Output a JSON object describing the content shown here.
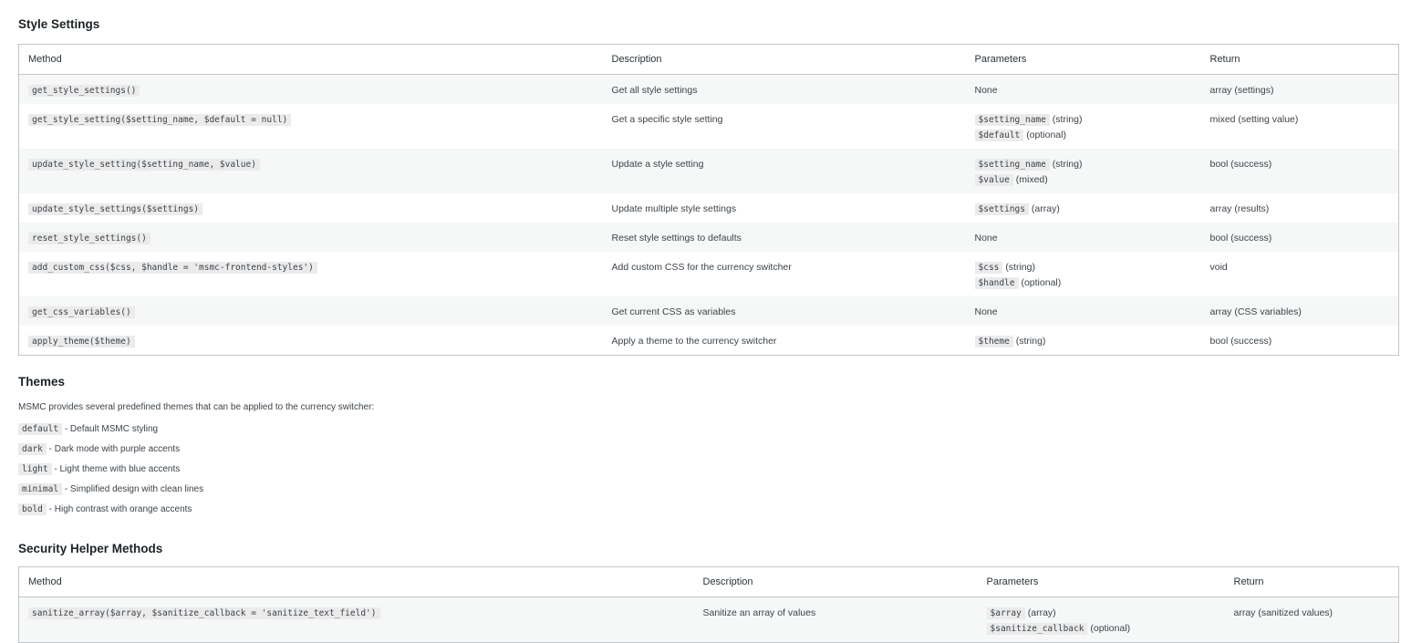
{
  "style_settings": {
    "title": "Style Settings",
    "headers": [
      "Method",
      "Description",
      "Parameters",
      "Return"
    ],
    "rows": [
      {
        "method": "get_style_settings()",
        "description": "Get all style settings",
        "params_plain": "None",
        "params": [],
        "return": "array (settings)"
      },
      {
        "method": "get_style_setting($setting_name, $default = null)",
        "description": "Get a specific style setting",
        "params_plain": "",
        "params": [
          {
            "code": "$setting_name",
            "note": "(string)"
          },
          {
            "code": "$default",
            "note": "(optional)"
          }
        ],
        "return": "mixed (setting value)"
      },
      {
        "method": "update_style_setting($setting_name, $value)",
        "description": "Update a style setting",
        "params_plain": "",
        "params": [
          {
            "code": "$setting_name",
            "note": "(string)"
          },
          {
            "code": "$value",
            "note": "(mixed)"
          }
        ],
        "return": "bool (success)"
      },
      {
        "method": "update_style_settings($settings)",
        "description": "Update multiple style settings",
        "params_plain": "",
        "params": [
          {
            "code": "$settings",
            "note": "(array)"
          }
        ],
        "return": "array (results)"
      },
      {
        "method": "reset_style_settings()",
        "description": "Reset style settings to defaults",
        "params_plain": "None",
        "params": [],
        "return": "bool (success)"
      },
      {
        "method": "add_custom_css($css, $handle = 'msmc-frontend-styles')",
        "description": "Add custom CSS for the currency switcher",
        "params_plain": "",
        "params": [
          {
            "code": "$css",
            "note": "(string)"
          },
          {
            "code": "$handle",
            "note": "(optional)"
          }
        ],
        "return": "void"
      },
      {
        "method": "get_css_variables()",
        "description": "Get current CSS as variables",
        "params_plain": "None",
        "params": [],
        "return": "array (CSS variables)"
      },
      {
        "method": "apply_theme($theme)",
        "description": "Apply a theme to the currency switcher",
        "params_plain": "",
        "params": [
          {
            "code": "$theme",
            "note": "(string)"
          }
        ],
        "return": "bool (success)"
      }
    ]
  },
  "themes": {
    "title": "Themes",
    "intro": "MSMC provides several predefined themes that can be applied to the currency switcher:",
    "items": [
      {
        "code": "default",
        "text": "- Default MSMC styling"
      },
      {
        "code": "dark",
        "text": "- Dark mode with purple accents"
      },
      {
        "code": "light",
        "text": "- Light theme with blue accents"
      },
      {
        "code": "minimal",
        "text": "- Simplified design with clean lines"
      },
      {
        "code": "bold",
        "text": "- High contrast with orange accents"
      }
    ]
  },
  "security": {
    "title": "Security Helper Methods",
    "headers": [
      "Method",
      "Description",
      "Parameters",
      "Return"
    ],
    "rows": [
      {
        "method": "sanitize_array($array, $sanitize_callback = 'sanitize_text_field')",
        "description": "Sanitize an array of values",
        "params_plain": "",
        "params": [
          {
            "code": "$array",
            "note": "(array)"
          },
          {
            "code": "$sanitize_callback",
            "note": "(optional)"
          }
        ],
        "return": "array (sanitized values)"
      }
    ]
  }
}
